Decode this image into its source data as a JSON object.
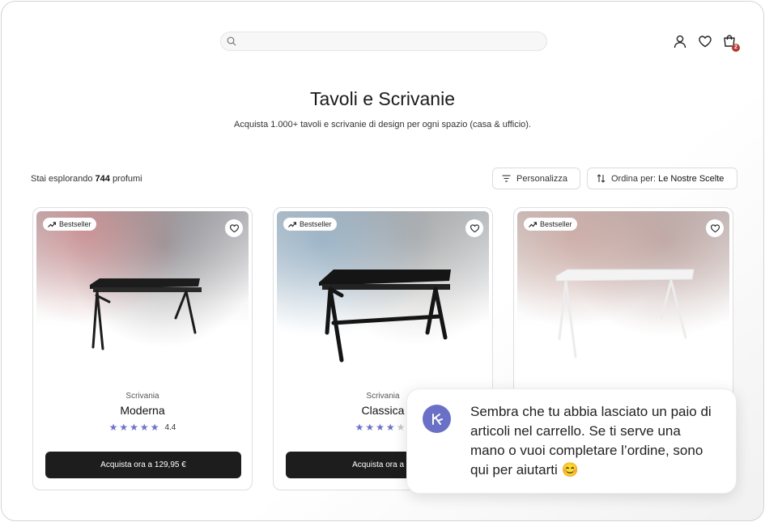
{
  "header": {
    "search_placeholder": "",
    "icons": [
      "search-icon",
      "user-icon",
      "heart-icon",
      "cart-icon"
    ],
    "cart_count": "2"
  },
  "page": {
    "title": "Tavoli e Scrivanie",
    "subtitle": "Acquista 1.000+ tavoli e scrivanie di design per ogni spazio (casa & ufficio)."
  },
  "toolbar": {
    "count_prefix": "Stai esplorando",
    "count_value": "744",
    "count_suffix": "profumi",
    "filter_label": "Personalizza",
    "sort_label": "Ordina per:",
    "sort_value": "Le Nostre Scelte"
  },
  "products": [
    {
      "badge": "Bestseller",
      "category": "Scrivania",
      "name": "Moderna",
      "rating": 4.4,
      "rating_label": "4.4",
      "cta": "Acquista ora a 129,95 €",
      "desk_color": "#1c1c1c"
    },
    {
      "badge": "Bestseller",
      "category": "Scrivania",
      "name": "Classica",
      "rating": 4,
      "rating_label": "",
      "cta": "Acquista ora a 10",
      "desk_color": "#151515"
    },
    {
      "badge": "Bestseller",
      "category": "",
      "name": "",
      "rating": null,
      "rating_label": "",
      "cta": "",
      "desk_color": "#f4f4f4"
    }
  ],
  "chat": {
    "message": "Sembra che tu abbia lasciato un paio di articoli nel carrello. Se ti serve una mano o vuoi completare l’ordine, sono qui per aiutarti 😊"
  },
  "colors": {
    "accent": "#6a70c5",
    "cta_bg": "#1d1d1d",
    "badge_red": "#b33a2f"
  }
}
